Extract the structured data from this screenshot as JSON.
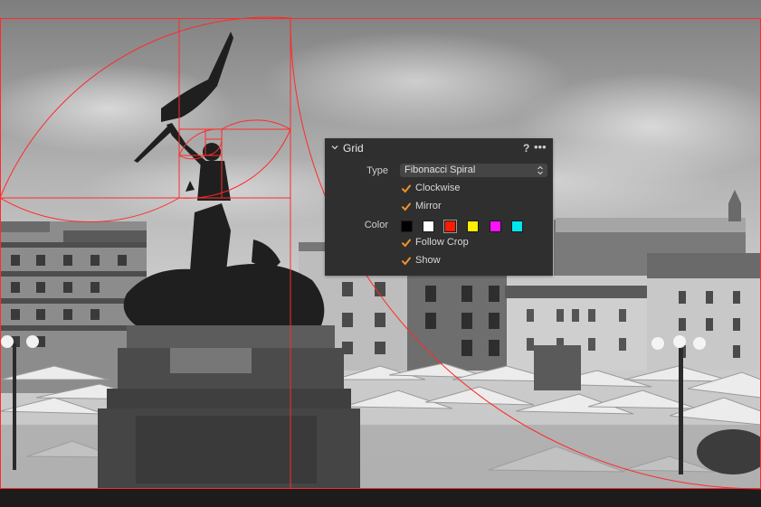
{
  "grid_panel": {
    "title": "Grid",
    "help": "?",
    "more": "•••",
    "type_label": "Type",
    "type_value": "Fibonacci Spiral",
    "color_label": "Color",
    "colors": [
      "#000000",
      "#ffffff",
      "#ff1a00",
      "#ffee00",
      "#ff10ff",
      "#00e5ee"
    ],
    "selected_color": "#ff1a00",
    "options": {
      "clockwise": {
        "label": "Clockwise",
        "checked": true
      },
      "mirror": {
        "label": "Mirror",
        "checked": true
      },
      "follow_crop": {
        "label": "Follow Crop",
        "checked": true
      },
      "show": {
        "label": "Show",
        "checked": true
      }
    }
  },
  "overlay": {
    "grid_type": "fibonacci-spiral",
    "line_color": "#ff2a2a"
  },
  "icons": {
    "collapse": "chevron-down-icon",
    "checkbox": "checkmark-icon",
    "select": "up-down-arrows-icon"
  }
}
